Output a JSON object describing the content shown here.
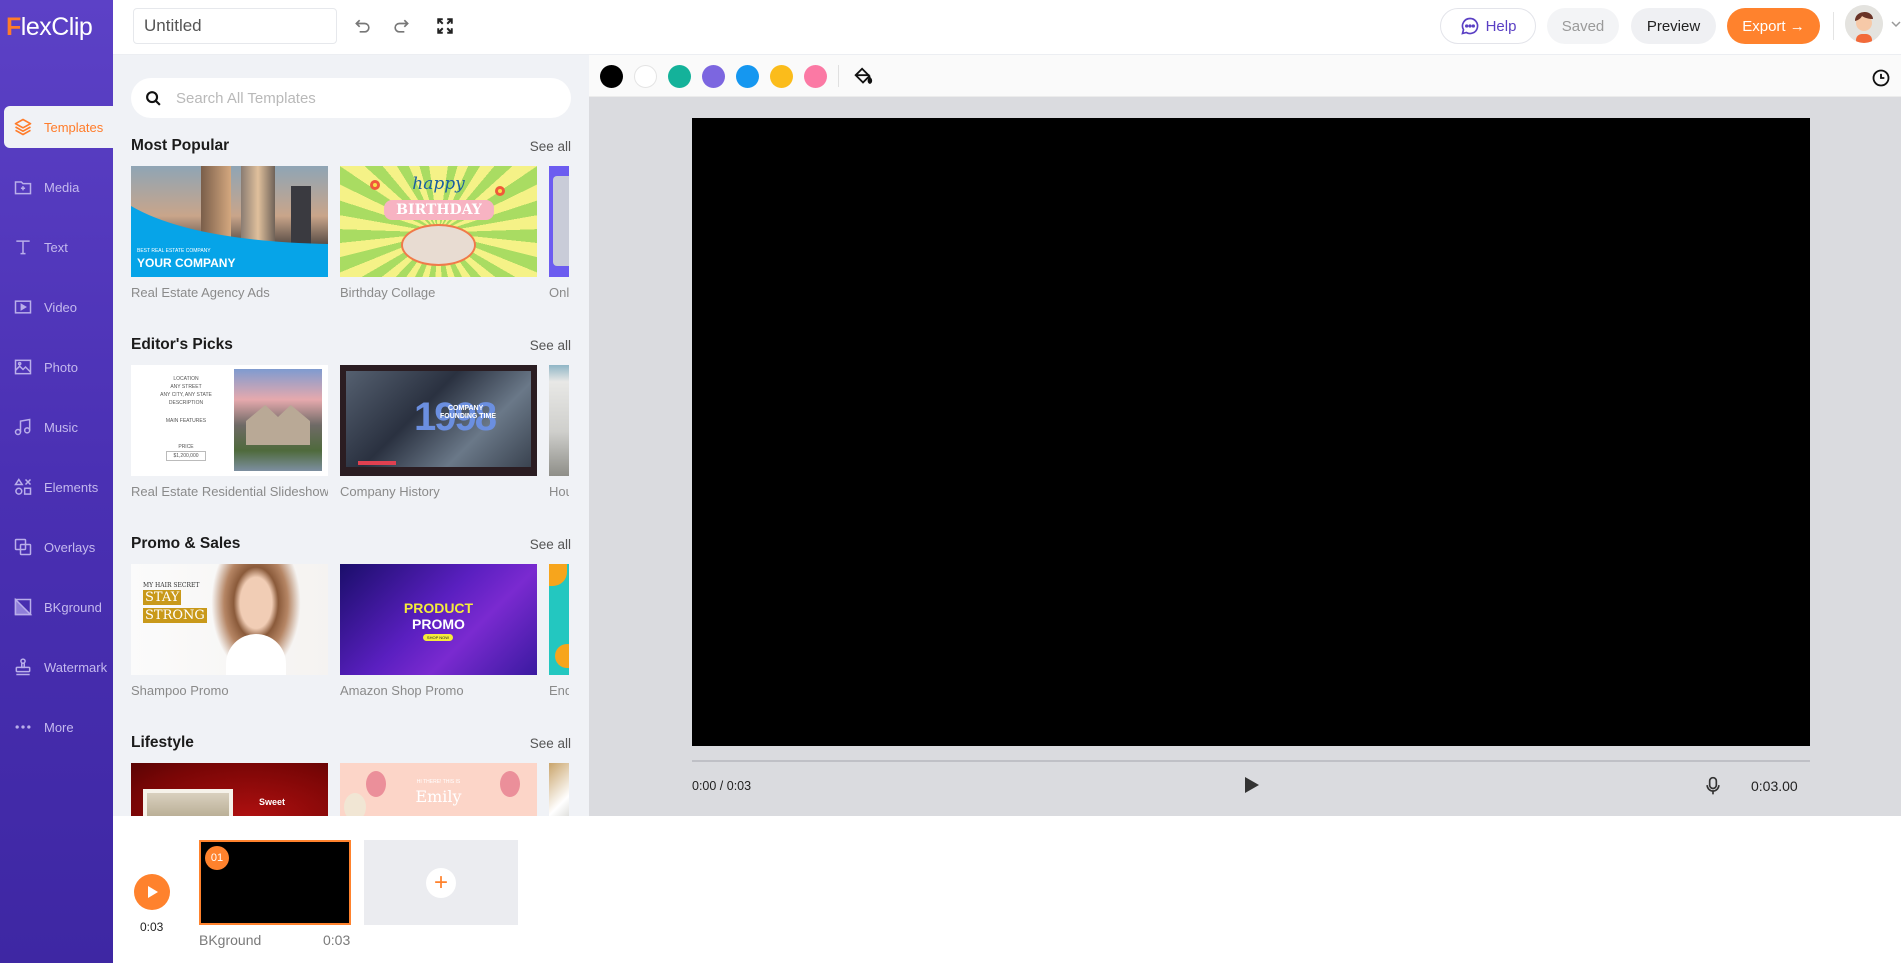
{
  "app": {
    "logo_f": "F",
    "logo_rest": "lexClip"
  },
  "sidebar": {
    "items": [
      {
        "label": "Templates",
        "icon": "layers-icon",
        "active": true
      },
      {
        "label": "Media",
        "icon": "folder-plus-icon"
      },
      {
        "label": "Text",
        "icon": "text-icon"
      },
      {
        "label": "Video",
        "icon": "video-icon"
      },
      {
        "label": "Photo",
        "icon": "photo-icon"
      },
      {
        "label": "Music",
        "icon": "music-icon"
      },
      {
        "label": "Elements",
        "icon": "shapes-icon"
      },
      {
        "label": "Overlays",
        "icon": "overlays-icon"
      },
      {
        "label": "BKground",
        "icon": "background-icon"
      },
      {
        "label": "Watermark",
        "icon": "stamp-icon"
      },
      {
        "label": "More",
        "icon": "more-icon"
      }
    ]
  },
  "topbar": {
    "project_title": "Untitled",
    "help_label": "Help",
    "saved_label": "Saved",
    "preview_label": "Preview",
    "export_label": "Export →"
  },
  "panel": {
    "search_placeholder": "Search All Templates",
    "sections": [
      {
        "title": "Most Popular",
        "see_all": "See all",
        "cards": [
          {
            "caption": "Real Estate Agency Ads",
            "thumb_text_small": "BEST REAL ESTATE COMPANY",
            "thumb_text": "YOUR COMPANY"
          },
          {
            "caption": "Birthday Collage",
            "thumb_text_small": "happy",
            "thumb_text": "BIRTHDAY"
          },
          {
            "caption": "Onl"
          }
        ]
      },
      {
        "title": "Editor's Picks",
        "see_all": "See all",
        "cards": [
          {
            "caption": "Real Estate Residential Slideshow",
            "thumb_lines": [
              "LOCATION",
              "ANY STREET",
              "ANY CITY, ANY STATE",
              "DESCRIPTION",
              "MAIN FEATURES",
              "PRICE",
              "$1,200,000"
            ]
          },
          {
            "caption": "Company History",
            "thumb_text_big": "1998",
            "thumb_text": "COMPANY",
            "thumb_text_small": "FOUNDING TIME"
          },
          {
            "caption": "Hou"
          }
        ]
      },
      {
        "title": "Promo & Sales",
        "see_all": "See all",
        "cards": [
          {
            "caption": "Shampoo Promo",
            "thumb_text_small": "MY HAIR SECRET",
            "thumb_lines": [
              "STAY",
              "STRONG"
            ]
          },
          {
            "caption": "Amazon Shop Promo",
            "thumb_lines": [
              "PRODUCT",
              "PROMO"
            ],
            "thumb_text_small": "SHOP NOW"
          },
          {
            "caption": "End"
          }
        ]
      },
      {
        "title": "Lifestyle",
        "see_all": "See all",
        "cards": [
          {
            "caption": "",
            "thumb_text": "Sweet"
          },
          {
            "caption": "",
            "thumb_text_small": "HI THERE! THIS IS",
            "thumb_text": "Emily"
          },
          {
            "caption": ""
          }
        ]
      }
    ]
  },
  "toolbar": {
    "swatches": [
      "#000000",
      "#ffffff",
      "#14b29a",
      "#7c66e0",
      "#1597f0",
      "#fbbc1b",
      "#fb79a4"
    ],
    "fill_icon": "paint-bucket-icon",
    "history_icon": "clock-icon"
  },
  "player": {
    "time": "0:00 / 0:03",
    "duration": "0:03.00",
    "progress": 0
  },
  "timeline": {
    "total_time": "0:03",
    "clips": [
      {
        "badge": "01",
        "name": "BKground",
        "duration": "0:03"
      }
    ],
    "add_label": "+"
  },
  "colors": {
    "accent": "#ff822d",
    "brand": "#5a3fc4"
  }
}
